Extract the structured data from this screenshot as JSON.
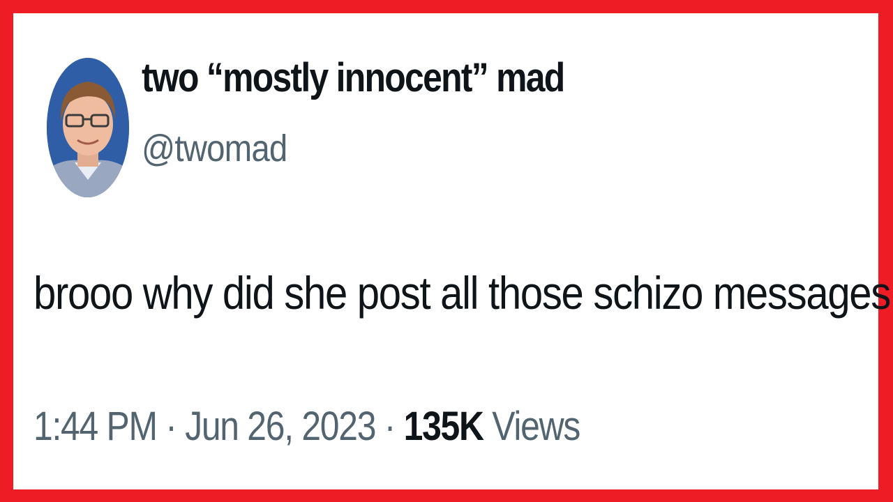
{
  "tweet": {
    "display_name": "two “mostly innocent” mad",
    "handle": "@twomad",
    "text": "brooo why did she post all those schizo messages",
    "time": "1:44 PM",
    "separator": " · ",
    "date": "Jun 26, 2023",
    "views_count": "135K",
    "views_label": " Views"
  },
  "colors": {
    "border": "#ee1c25",
    "primary_text": "#0f1419",
    "secondary_text": "#536471"
  }
}
